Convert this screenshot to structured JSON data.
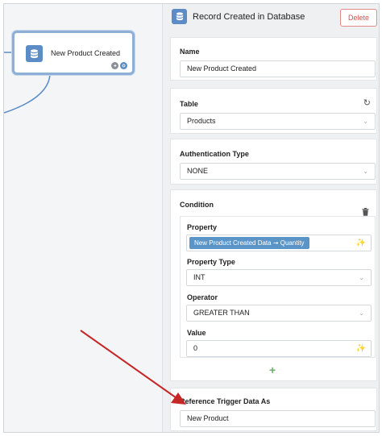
{
  "canvas": {
    "node": {
      "label": "New Product Created"
    }
  },
  "panel": {
    "title": "Record Created in Database",
    "delete_label": "Delete",
    "name": {
      "label": "Name",
      "value": "New Product Created"
    },
    "table": {
      "label": "Table",
      "value": "Products"
    },
    "auth": {
      "label": "Authentication Type",
      "value": "NONE"
    },
    "condition": {
      "label": "Condition",
      "property": {
        "label": "Property",
        "pill": "New Product Created Data ➞  Quantity"
      },
      "property_type": {
        "label": "Property Type",
        "value": "INT"
      },
      "operator": {
        "label": "Operator",
        "value": "GREATER THAN"
      },
      "value": {
        "label": "Value",
        "value": "0"
      }
    },
    "reference": {
      "label": "Reference Trigger Data As",
      "value": "New Product"
    }
  },
  "colors": {
    "accent": "#5b8cc6",
    "delete": "#d9534f",
    "arrow": "#c62828",
    "add": "#6bb36b"
  }
}
